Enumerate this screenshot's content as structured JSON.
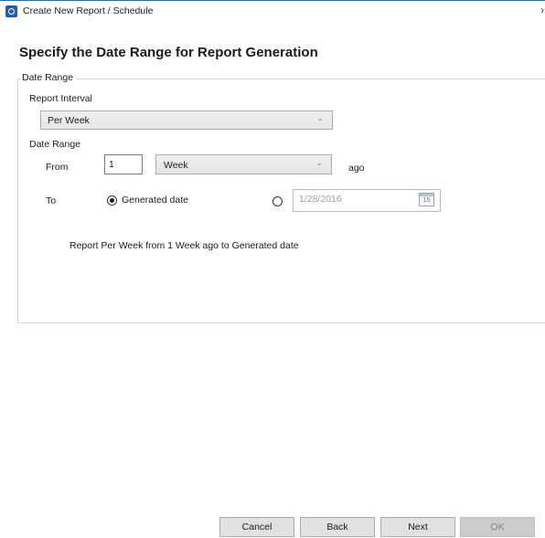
{
  "window": {
    "title": "Create New Report / Schedule",
    "chevron": "›",
    "icon": "report-app-icon"
  },
  "heading": "Specify the Date Range for Report Generation",
  "group": {
    "legend": "Date Range",
    "report_interval_label": "Report Interval",
    "report_interval_value": "Per Week",
    "date_range_label": "Date Range",
    "from_label": "From",
    "from_value": "1",
    "from_unit_value": "Week",
    "ago_label": "ago",
    "to_label": "To",
    "generated_date_label": "Generated date",
    "generated_date_selected": true,
    "specific_date_selected": false,
    "specific_date_value": "1/28/2016",
    "calendar_day": "15",
    "summary": "Report Per Week from 1 Week ago to Generated date"
  },
  "dropdown_arrow": "⌄",
  "buttons": {
    "cancel": "Cancel",
    "back": "Back",
    "next": "Next",
    "ok": "OK"
  },
  "colors": {
    "accent": "#1f5fa8",
    "title_border": "#2b6fb3",
    "button_face": "#e1e1e1",
    "disabled_button": "#cccccc"
  }
}
